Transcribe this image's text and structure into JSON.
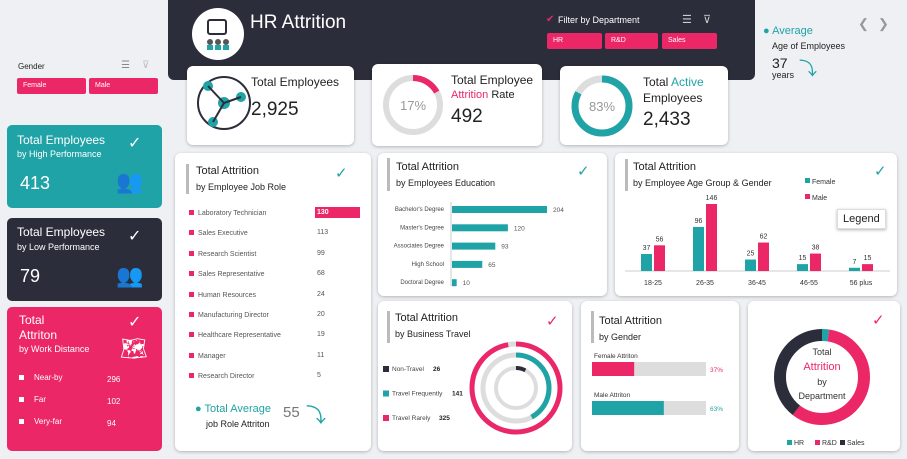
{
  "header": {
    "title": "HR Attrition",
    "filter_label": "Filter by Department",
    "filters": [
      "HR",
      "R&D",
      "Sales"
    ]
  },
  "gender": {
    "label": "Gender",
    "options": [
      "Female",
      "Male"
    ]
  },
  "average_age": {
    "title": "Average",
    "subtitle": "Age of Employees",
    "value": "37",
    "unit": "years"
  },
  "nav": {
    "prev": "❮",
    "next": "❯"
  },
  "kpis": {
    "total_employees": {
      "label": "Total Employees",
      "value": "2,925"
    },
    "attrition": {
      "label1": "Total Employee",
      "label2a": "Attrition",
      "label2b": " Rate",
      "value": "492",
      "percent": "17%",
      "pct_num": 17
    },
    "active": {
      "label1a": "Total ",
      "label1b": "Active",
      "label2": "Employees",
      "value": "2,433",
      "percent": "83%",
      "pct_num": 83
    }
  },
  "high_perf": {
    "title": "Total Employees",
    "subtitle": "by High Performance",
    "value": "413"
  },
  "low_perf": {
    "title": "Total Employees",
    "subtitle": "by Low Performance",
    "value": "79"
  },
  "distance": {
    "title1": "Total",
    "title2": "Attriton",
    "subtitle": "by Work Distance",
    "items": [
      {
        "label": "Near-by",
        "value": "296"
      },
      {
        "label": "Far",
        "value": "102"
      },
      {
        "label": "Very-far",
        "value": "94"
      }
    ]
  },
  "job_role": {
    "title": "Total Attrition",
    "subtitle": "by Employee Job Role",
    "avg_title": "Total Average",
    "avg_sub": "job Role Attriton",
    "avg_value": "55"
  },
  "legend_tip": "Legend",
  "chart_data": [
    {
      "type": "table",
      "title": "Total Attrition",
      "subtitle": "by Employee Job Role",
      "categories": [
        "Laboratory Technician",
        "Sales Executive",
        "Research Scientist",
        "Sales Representative",
        "Human Resources",
        "Manufacturing Director",
        "Healthcare Representative",
        "Manager",
        "Research Director"
      ],
      "values": [
        130,
        113,
        99,
        68,
        24,
        20,
        19,
        11,
        5
      ]
    },
    {
      "type": "bar",
      "title": "Total Attrition",
      "subtitle": "by Employees Education",
      "categories": [
        "Bachelor's Degree",
        "Master's Degree",
        "Associates Degree",
        "High School",
        "Doctoral Degree"
      ],
      "values": [
        204,
        120,
        93,
        65,
        10
      ]
    },
    {
      "type": "bar",
      "title": "Total Attrition",
      "subtitle": "by Employee Age Group & Gender",
      "categories": [
        "18-25",
        "26-35",
        "36-45",
        "46-55",
        "56 plus"
      ],
      "series": [
        {
          "name": "Female",
          "values": [
            37,
            96,
            25,
            15,
            7
          ],
          "color": "#1fa3a6"
        },
        {
          "name": "Male",
          "values": [
            56,
            146,
            62,
            38,
            15
          ],
          "color": "#ec2768"
        }
      ]
    },
    {
      "type": "pie",
      "title": "Total Attrition",
      "subtitle": "by Business Travel",
      "categories": [
        "Non-Travel",
        "Travel Frequently",
        "Travel Rarely"
      ],
      "values": [
        26,
        141,
        325
      ]
    },
    {
      "type": "bar",
      "title": "Total Attrition",
      "subtitle": "by Gender",
      "categories": [
        "Female Attriton",
        "Male Attriton"
      ],
      "values": [
        37,
        63
      ],
      "labels": [
        "37%",
        "63%"
      ]
    },
    {
      "type": "pie",
      "title": "Total Attrition by Department",
      "title_parts": [
        "Total",
        "Attrition",
        "by",
        "Department"
      ],
      "categories": [
        "HR",
        "R&D",
        "Sales"
      ],
      "values": [
        12,
        285,
        195
      ],
      "colors": [
        "#1fa3a6",
        "#ec2768",
        "#2b2d3a"
      ]
    }
  ]
}
